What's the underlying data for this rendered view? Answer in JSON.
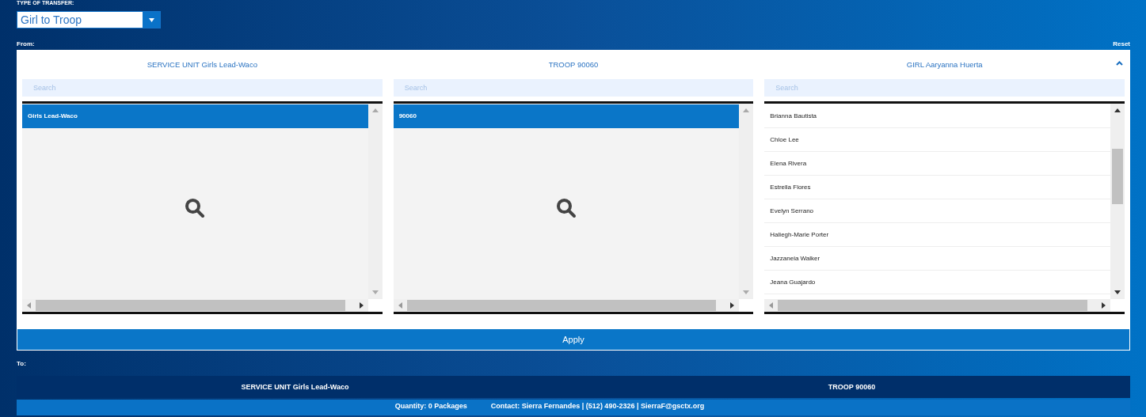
{
  "transfer_type": {
    "label": "TYPE OF TRANSFER:",
    "value": "Girl to Troop"
  },
  "from_label": "From:",
  "reset": "Reset",
  "from_panel": {
    "expanded": true,
    "columns": [
      {
        "header": "SERVICE UNIT Girls Lead-Waco",
        "search": {
          "placeholder": "Search"
        },
        "items": [
          {
            "label": "Girls Lead-Waco",
            "selected": true
          }
        ]
      },
      {
        "header": "TROOP 90060",
        "search": {
          "placeholder": "Search"
        },
        "items": [
          {
            "label": "90060",
            "selected": true
          }
        ]
      },
      {
        "header": "GIRL Aaryanna Huerta",
        "search": {
          "placeholder": "Search"
        },
        "items": [
          {
            "label": "Brianna Bautista",
            "selected": false
          },
          {
            "label": "Chloe Lee",
            "selected": false
          },
          {
            "label": "Elena Rivera",
            "selected": false
          },
          {
            "label": "Estrella Flores",
            "selected": false
          },
          {
            "label": "Evelyn Serrano",
            "selected": false
          },
          {
            "label": "Haliegh-Marie Porter",
            "selected": false
          },
          {
            "label": "Jazzaneia Walker",
            "selected": false
          },
          {
            "label": "Jeana Guajardo",
            "selected": false
          }
        ]
      }
    ]
  },
  "apply_button": "Apply",
  "to_label": "To:",
  "to_bar": [
    "SERVICE UNIT Girls Lead-Waco",
    "TROOP 90060"
  ],
  "footer": [
    "Quantity: 0 Packages",
    "Contact: Sierra Fernandes | (512) 490-2326 | SierraF@gsctx.org"
  ]
}
